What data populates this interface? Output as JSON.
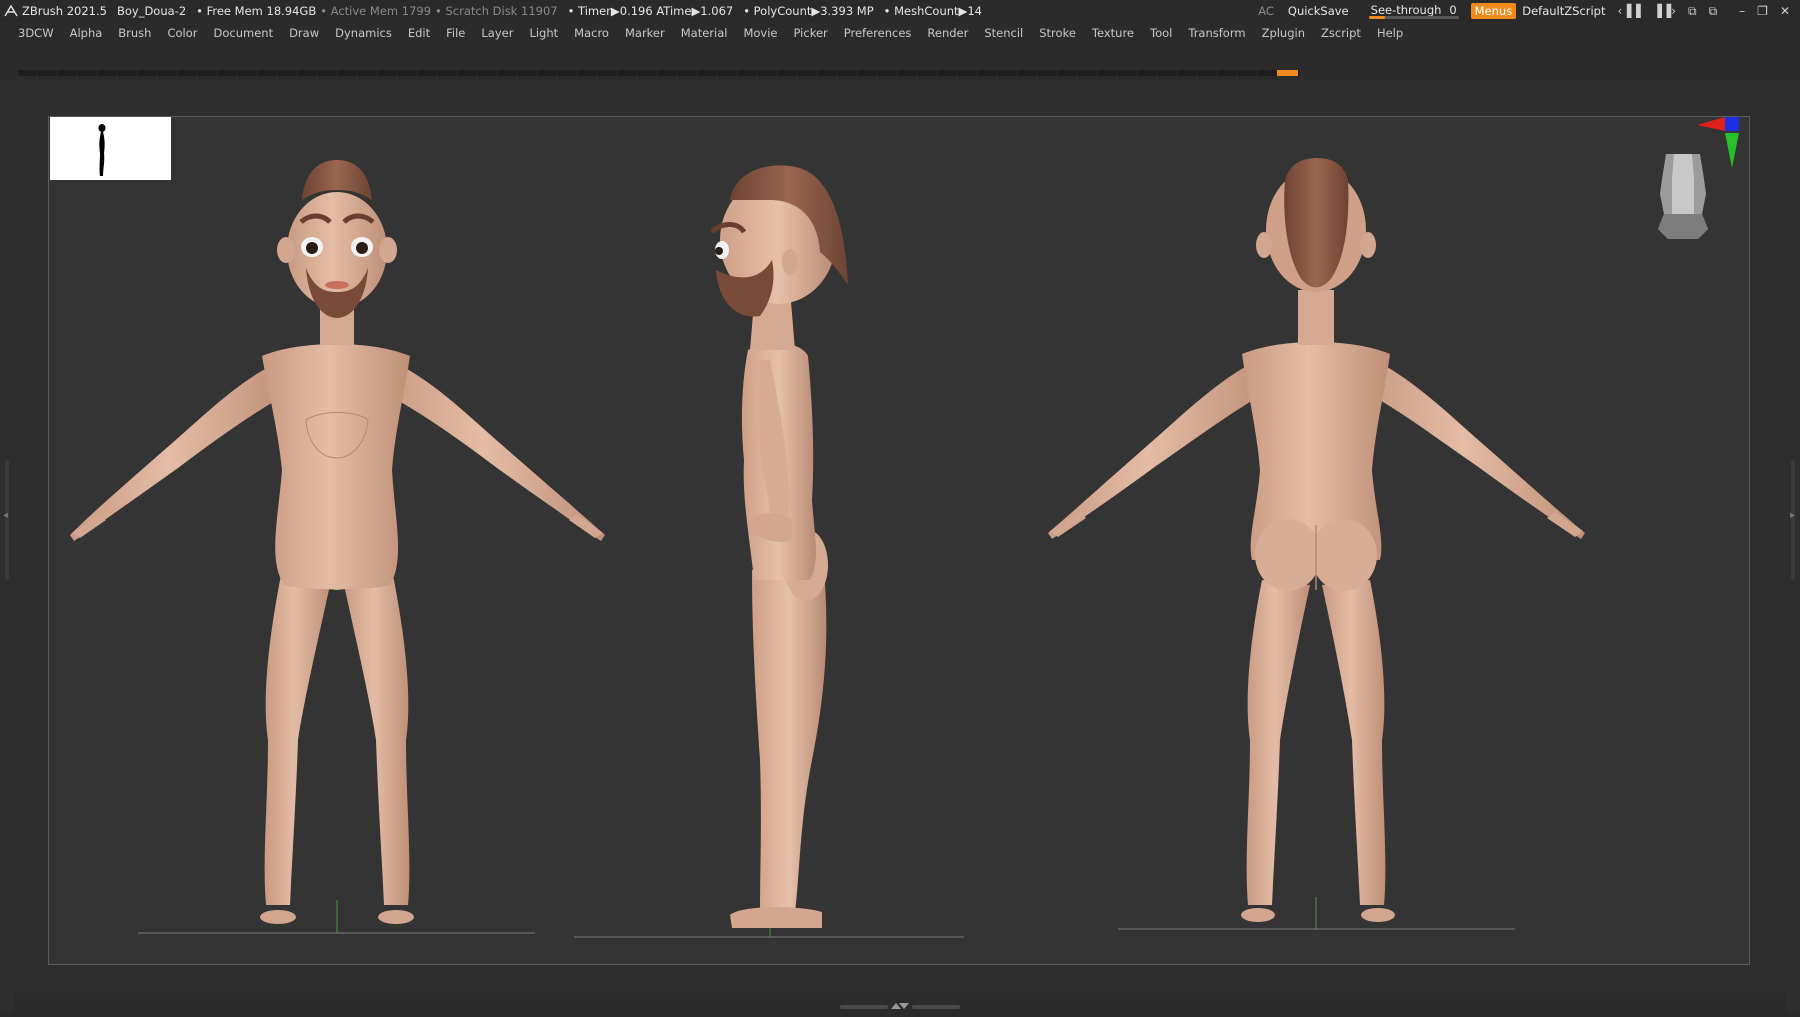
{
  "titlebar": {
    "app": "ZBrush 2021.5",
    "project": "Boy_Doua-2",
    "free_mem": "• Free Mem 18.94GB",
    "active_mem": "• Active Mem 1799",
    "scratch": "• Scratch Disk 11907",
    "timer": "• Timer▶0.196 ATime▶1.067",
    "polycount": "• PolyCount▶3.393 MP",
    "meshcount": "• MeshCount▶14",
    "ac": "AC",
    "quicksave": "QuickSave",
    "seethrough_label": "See-through",
    "seethrough_value": "0",
    "seethrough_level": 0.18,
    "menus": "Menus",
    "script": "DefaultZScript"
  },
  "menubar": {
    "items": [
      "3DCW",
      "Alpha",
      "Brush",
      "Color",
      "Document",
      "Draw",
      "Dynamics",
      "Edit",
      "File",
      "Layer",
      "Light",
      "Macro",
      "Marker",
      "Material",
      "Movie",
      "Picker",
      "Preferences",
      "Render",
      "Stencil",
      "Stroke",
      "Texture",
      "Tool",
      "Transform",
      "Zplugin",
      "Zscript",
      "Help"
    ]
  },
  "icons": {
    "logo": "zbrush-logo-icon",
    "window_controls": [
      "minimize-icon",
      "restore-icon",
      "close-icon"
    ]
  },
  "colors": {
    "accent": "#ef8a1b",
    "skin": "#d8ad95",
    "hair": "#8a5a44",
    "beard": "#7a4a38"
  }
}
